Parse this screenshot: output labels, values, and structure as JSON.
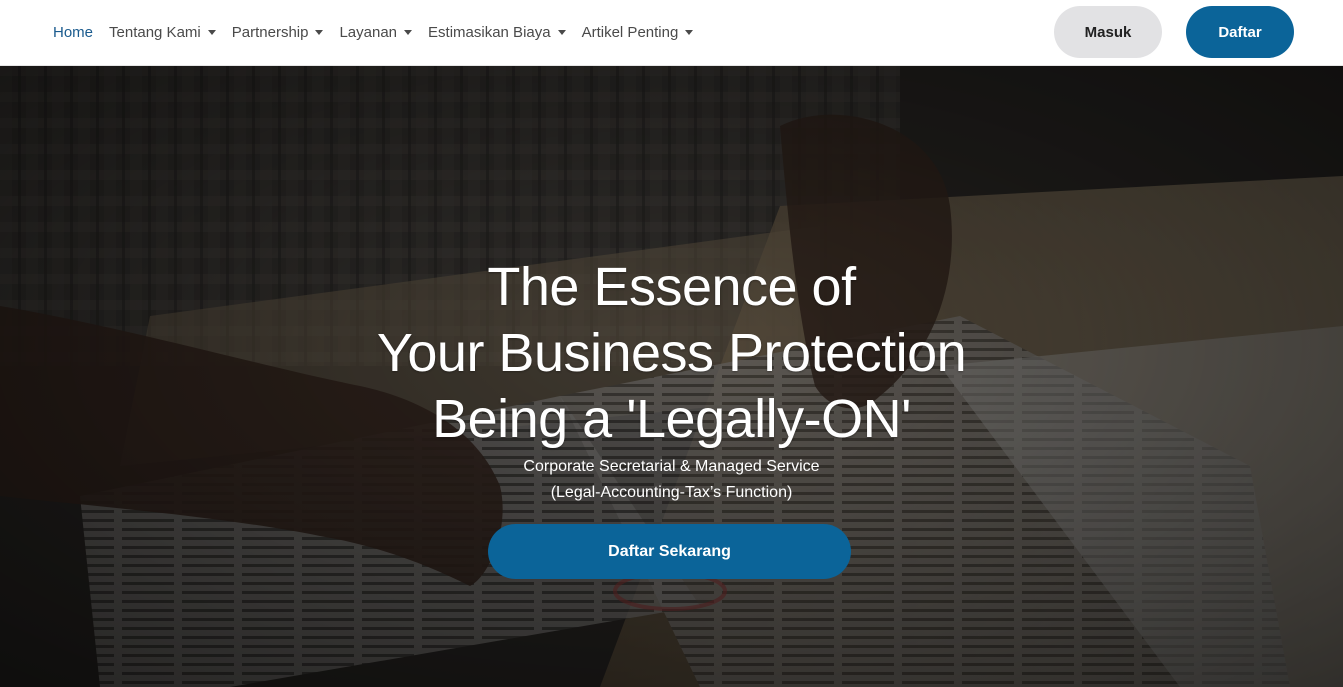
{
  "nav": {
    "items": [
      {
        "label": "Home",
        "active": true,
        "dropdown": false
      },
      {
        "label": "Tentang Kami",
        "active": false,
        "dropdown": true
      },
      {
        "label": "Partnership",
        "active": false,
        "dropdown": true
      },
      {
        "label": "Layanan",
        "active": false,
        "dropdown": true
      },
      {
        "label": "Estimasikan Biaya",
        "active": false,
        "dropdown": true
      },
      {
        "label": "Artikel Penting",
        "active": false,
        "dropdown": true
      }
    ],
    "login_label": "Masuk",
    "register_label": "Daftar"
  },
  "hero": {
    "title_lines": [
      "The Essence of",
      "Your Business Protection",
      "Being a 'Legally-ON'"
    ],
    "subtitle_lines": [
      "Corporate Secretarial & Managed Service",
      "(Legal-Accounting-Tax’s Function)"
    ],
    "cta_label": "Daftar Sekarang"
  },
  "colors": {
    "accent": "#0b6499",
    "active_link": "#1a5b8e",
    "login_bg": "#e2e2e4"
  }
}
